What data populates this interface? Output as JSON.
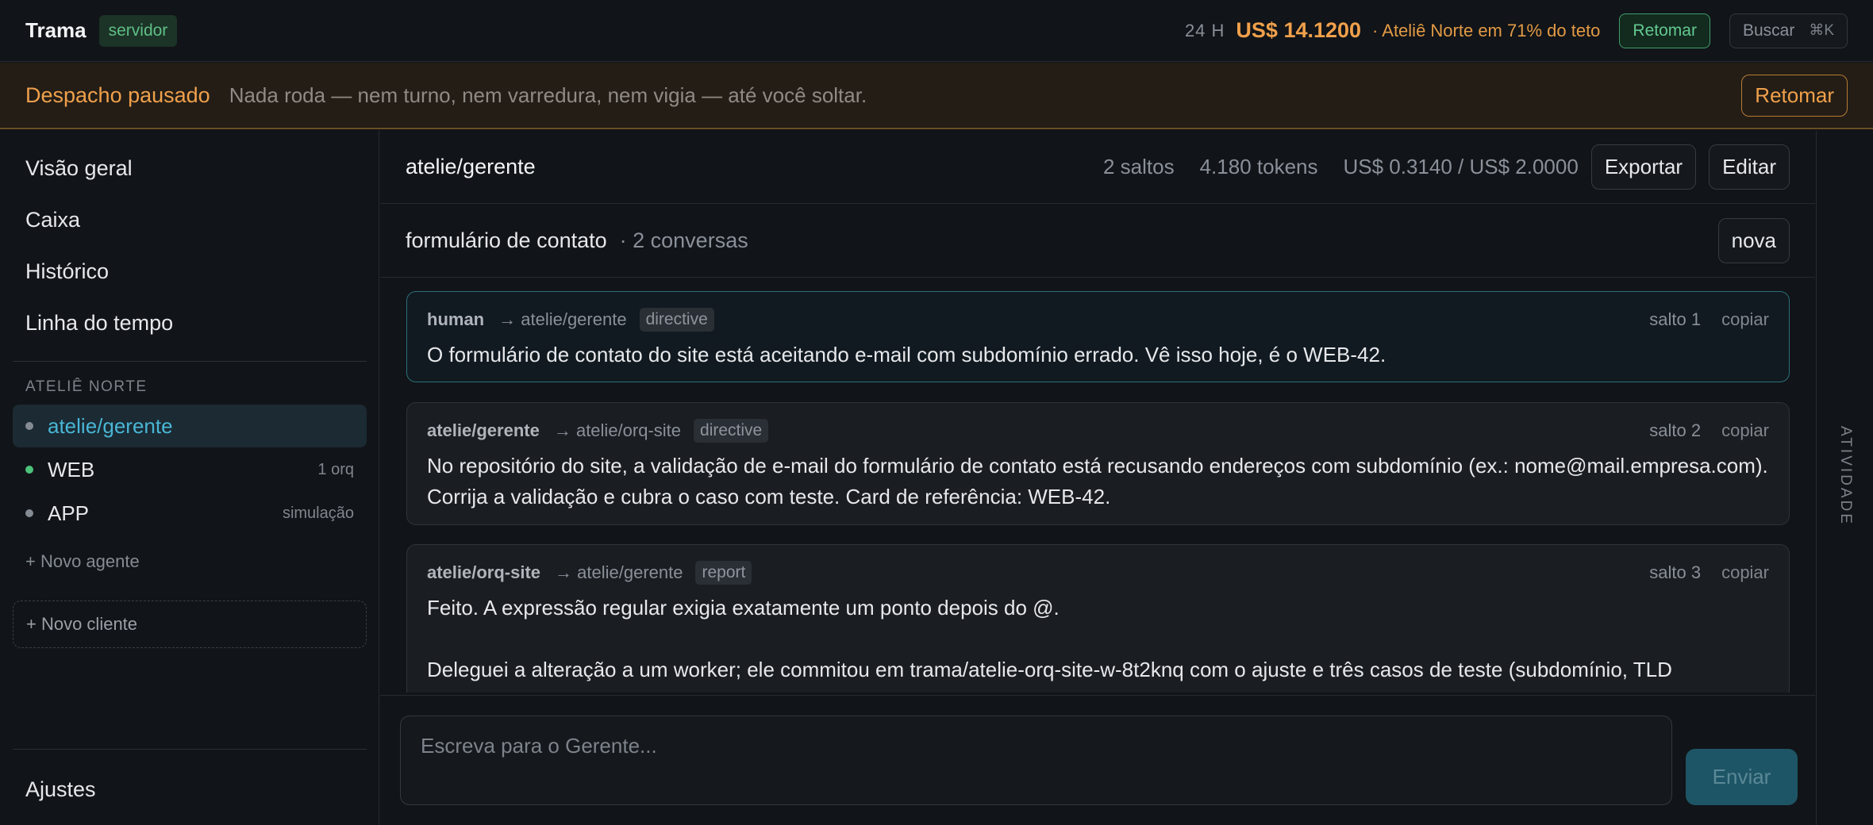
{
  "topbar": {
    "brand": "Trama",
    "badge": "servidor",
    "period": "24 H",
    "cost": "US$ 14.1200",
    "cost_note": "· Ateliê Norte em 71% do teto",
    "resume_label": "Retomar",
    "search_label": "Buscar",
    "search_shortcut": "⌘K"
  },
  "banner": {
    "title": "Despacho pausado",
    "message": "Nada roda — nem turno, nem varredura, nem vigia — até você soltar.",
    "button": "Retomar"
  },
  "sidebar": {
    "nav": [
      "Visão geral",
      "Caixa",
      "Histórico",
      "Linha do tempo"
    ],
    "section": "ATELIÊ NORTE",
    "agents": [
      {
        "name": "atelie/gerente",
        "meta": "",
        "status": "idle"
      },
      {
        "name": "WEB",
        "meta": "1 orq",
        "status": "active"
      },
      {
        "name": "APP",
        "meta": "simulação",
        "status": "idle"
      }
    ],
    "new_agent": "+ Novo agente",
    "new_client": "+ Novo cliente",
    "settings": "Ajustes"
  },
  "main": {
    "agent": "atelie/gerente",
    "hops": "2 saltos",
    "tokens": "4.180 tokens",
    "budget": "US$ 0.3140 / US$ 2.0000",
    "export": "Exportar",
    "edit": "Editar",
    "conversation": "formulário de contato",
    "conversation_count": "· 2 conversas",
    "new": "nova",
    "messages": [
      {
        "from": "human",
        "to": "→ atelie/gerente",
        "kind": "directive",
        "hop": "salto 1",
        "copy": "copiar",
        "body": "O formulário de contato do site está aceitando e-mail com subdomínio errado. Vê isso hoje, é o WEB-42."
      },
      {
        "from": "atelie/gerente",
        "to": "→ atelie/orq-site",
        "kind": "directive",
        "hop": "salto 2",
        "copy": "copiar",
        "body": "No repositório do site, a validação de e-mail do formulário de contato está recusando endereços com subdomínio (ex.: nome@mail.empresa.com). Corrija a validação e cubra o caso com teste. Card de referência: WEB-42."
      },
      {
        "from": "atelie/orq-site",
        "to": "→ atelie/gerente",
        "kind": "report",
        "hop": "salto 3",
        "copy": "copiar",
        "body": "Feito. A expressão regular exigia exatamente um ponto depois do @.\n\nDeleguei a alteração a um worker; ele commitou em trama/atelie-orq-site-w-8t2knq com o ajuste e três casos de teste (subdomínio, TLD"
      }
    ],
    "composer_placeholder": "Escreva para o Gerente...",
    "send": "Enviar"
  },
  "rail": {
    "label": "ATIVIDADE"
  }
}
